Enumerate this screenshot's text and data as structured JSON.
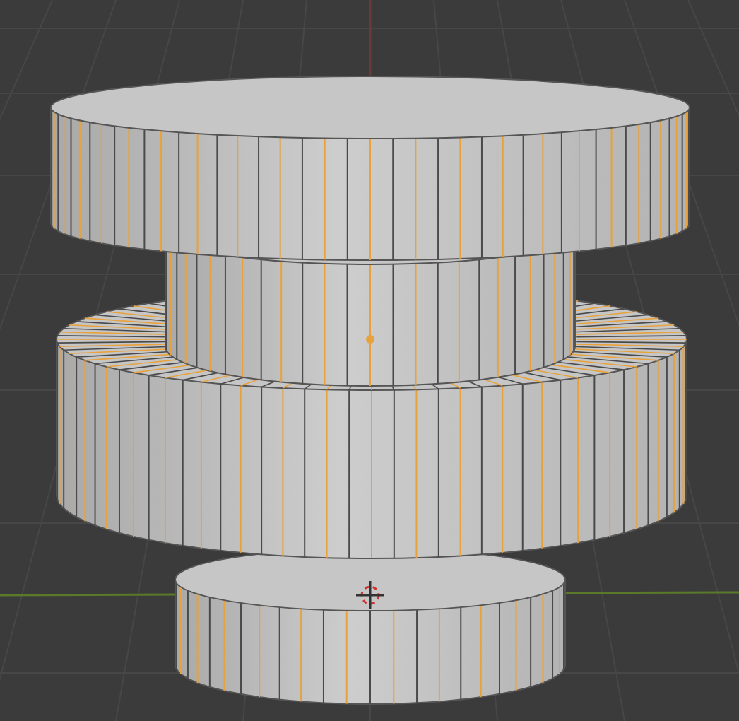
{
  "viewport": {
    "edges_selected": true
  }
}
